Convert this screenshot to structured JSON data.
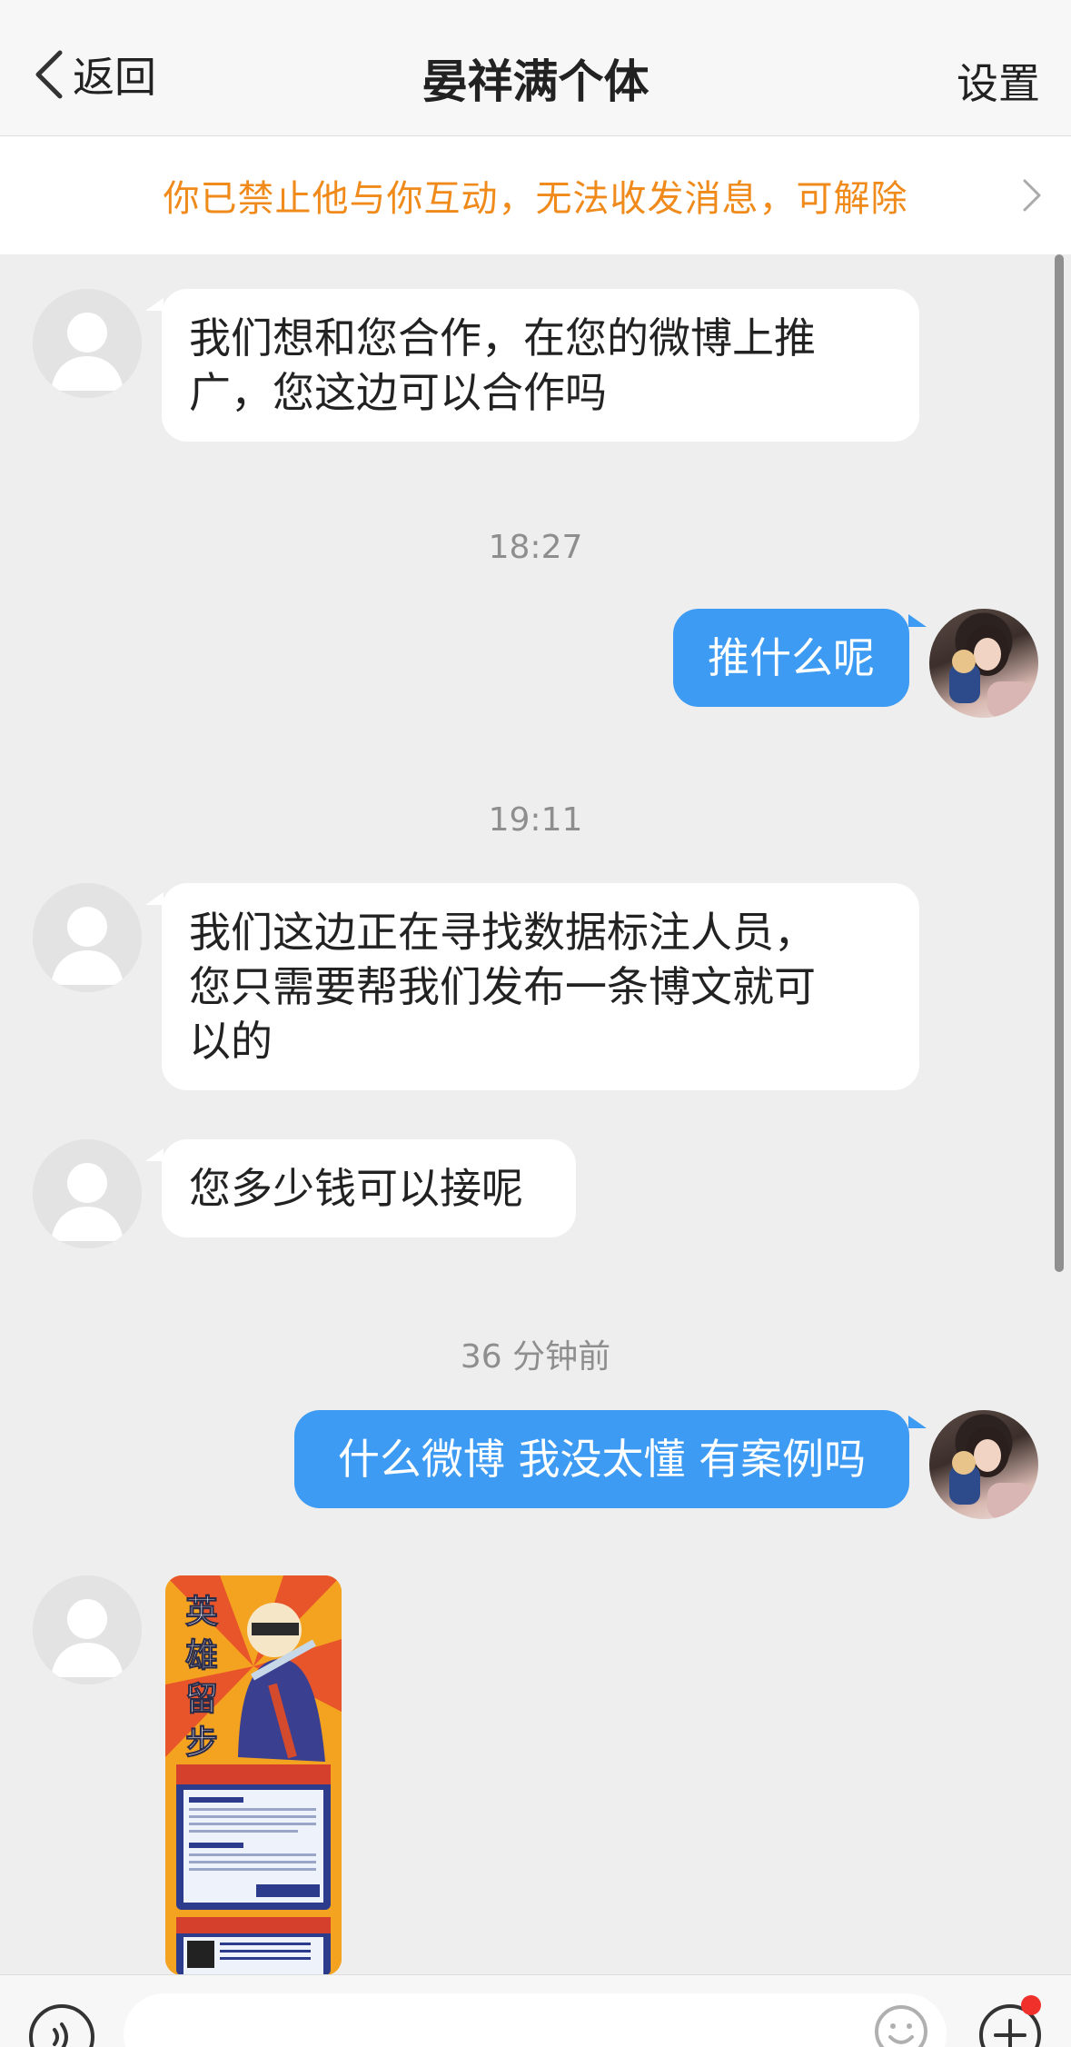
{
  "header": {
    "back_label": "返回",
    "title": "晏祥满个体",
    "settings_label": "设置"
  },
  "notice": {
    "text": "你已禁止他与你互动，无法收发消息，可解除"
  },
  "messages": [
    {
      "side": "in",
      "text_lines": [
        "我们想和您合作，在您的微博上推",
        "广，您这边可以合作吗"
      ]
    },
    {
      "side": "out",
      "text": "推什么呢"
    },
    {
      "side": "in",
      "text_lines": [
        "我们这边正在寻找数据标注人员，",
        "您只需要帮我们发布一条博文就可",
        "以的"
      ]
    },
    {
      "side": "in",
      "text": "您多少钱可以接呢"
    },
    {
      "side": "out",
      "text": "什么微博 我没太懂 有案例吗"
    },
    {
      "side": "in",
      "type": "image",
      "poster_title": "英雄留步"
    }
  ],
  "timestamps": [
    "18:27",
    "19:11",
    "36 分钟前"
  ],
  "bottom": {
    "input_value": "",
    "input_placeholder": ""
  },
  "colors": {
    "accent_blue": "#3d9bf3",
    "notice_orange": "#ef8a1b",
    "badge_red": "#f0302a"
  }
}
